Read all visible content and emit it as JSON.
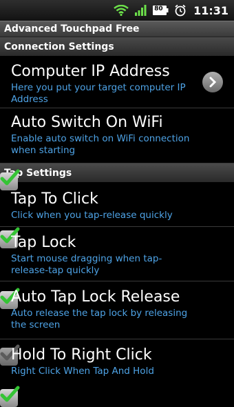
{
  "status_bar": {
    "time": "11:31",
    "battery": "80"
  },
  "app_title": "Advanced Touchpad Free",
  "sections": [
    {
      "label": "Connection Settings"
    },
    {
      "label": "Tap Settings"
    }
  ],
  "prefs": [
    {
      "title": "Computer IP Address",
      "summary": "Here you put your target computer IP Address",
      "widget": "chevron-right-icon"
    },
    {
      "title": "Auto Switch On WiFi",
      "summary": "Enable auto switch on WiFi connection when starting",
      "checked": true
    },
    {
      "title": "Tap To Click",
      "summary": "Click when you tap-release quickly",
      "checked": true
    },
    {
      "title": "Tap Lock",
      "summary": "Start mouse dragging when tap-release-tap quickly",
      "checked": true
    },
    {
      "title": "Auto Tap Lock Release",
      "summary": "Auto release the tap lock by releasing the screen",
      "checked": false,
      "enabled": false
    },
    {
      "title": "Hold To Right Click",
      "summary": "Right Click When Tap And Hold",
      "checked": true
    }
  ],
  "colors": {
    "summary_text": "#4ea3e6",
    "check_green": "#35c435",
    "check_disabled": "#7a7a7a"
  }
}
